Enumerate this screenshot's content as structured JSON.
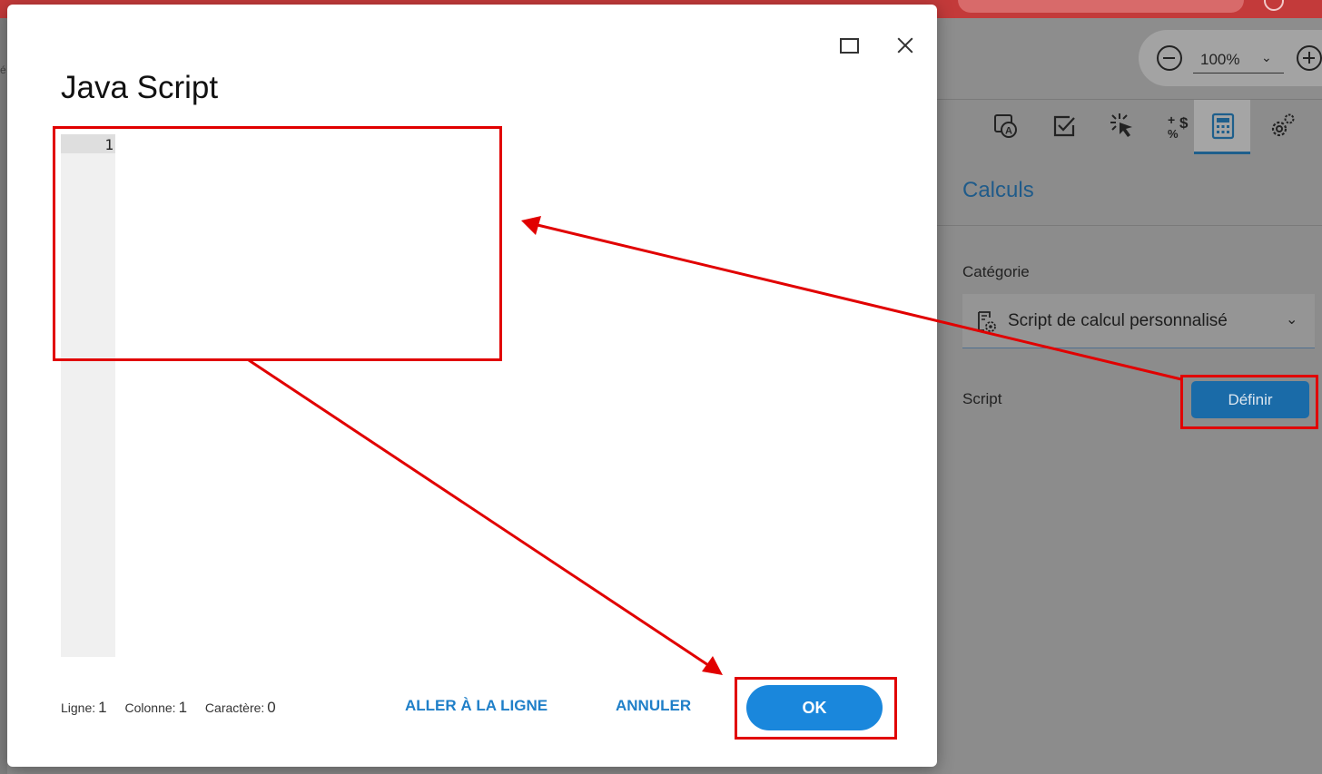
{
  "app": {
    "zoom_value": "100%",
    "tabs": [
      {
        "icon": "form-field-icon"
      },
      {
        "icon": "checkbox-icon"
      },
      {
        "icon": "action-click-icon"
      },
      {
        "icon": "format-number-icon"
      },
      {
        "icon": "calculator-icon",
        "active": true
      },
      {
        "icon": "settings-icon"
      }
    ],
    "section_title": "Calculs",
    "category_label": "Catégorie",
    "category_value": "Script de calcul personnalisé",
    "script_label": "Script",
    "define_button": "Définir"
  },
  "dialog": {
    "title": "Java Script",
    "editor": {
      "line_numbers": [
        "1"
      ]
    },
    "status": {
      "line_label": "Ligne:",
      "line_value": "1",
      "column_label": "Colonne:",
      "column_value": "1",
      "char_label": "Caractère:",
      "char_value": "0"
    },
    "goto_button": "ALLER À LA LIGNE",
    "cancel_button": "ANNULER",
    "ok_button": "OK"
  },
  "colors": {
    "annotation": "#e10000",
    "accent": "#1a87dc",
    "panel_accent": "#1f5b8a"
  }
}
